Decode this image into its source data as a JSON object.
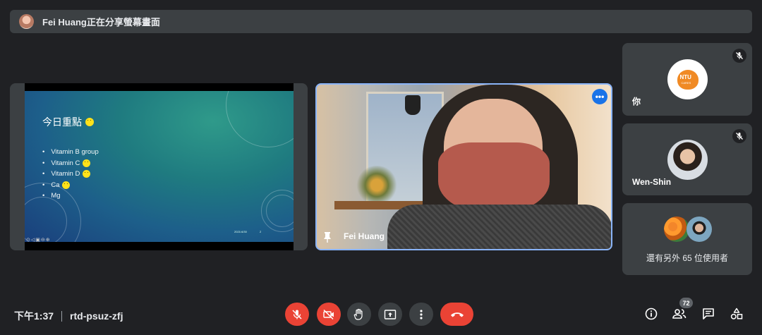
{
  "banner": {
    "text": "Fei Huang正在分享螢幕畫面"
  },
  "slide": {
    "title": "今日重點",
    "items": [
      {
        "text": "Vitamin B group",
        "smiley": false
      },
      {
        "text": "Vitamin C",
        "smiley": true
      },
      {
        "text": "Vitamin D",
        "smiley": true
      },
      {
        "text": "Ca",
        "smiley": true
      },
      {
        "text": "Mg",
        "smiley": false
      }
    ],
    "date": "2021/4/30",
    "page": "2"
  },
  "presenter": {
    "name": "Fei Huang"
  },
  "participants": [
    {
      "label": "你",
      "muted": true,
      "avatar": "ntu-cares-logo",
      "logo_text": "NTU",
      "logo_sub": "CARES"
    },
    {
      "label": "Wen-Shin",
      "muted": true,
      "avatar": "photo"
    }
  ],
  "others": {
    "text": "還有另外 65 位使用者"
  },
  "meeting": {
    "time": "下午1:37",
    "code": "rtd-psuz-zfj"
  },
  "people_count": "72",
  "colors": {
    "accent": "#8ab4f8",
    "danger": "#ea4335",
    "surface": "#3c4043",
    "background": "#202124"
  }
}
